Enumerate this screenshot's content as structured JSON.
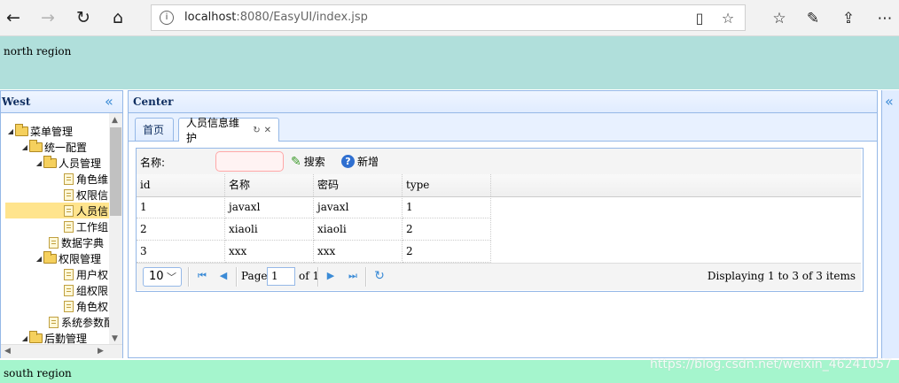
{
  "browser": {
    "url_host": "localhost",
    "url_rest": ":8080/EasyUI/index.jsp",
    "icons": [
      "back-icon",
      "forward-icon",
      "refresh-icon",
      "home-icon",
      "info-icon",
      "reading-view-icon",
      "favorite-star-icon",
      "favorites-list-icon",
      "notes-pen-icon",
      "share-icon",
      "more-icon"
    ]
  },
  "north": {
    "text": "north region"
  },
  "west": {
    "title": "West",
    "tree": [
      {
        "label": "菜单管理",
        "type": "folder"
      },
      {
        "label": "统一配置",
        "type": "folder"
      },
      {
        "label": "人员管理",
        "type": "folder"
      },
      {
        "label": "角色维",
        "type": "file"
      },
      {
        "label": "权限信",
        "type": "file"
      },
      {
        "label": "人员信",
        "type": "file",
        "selected": true
      },
      {
        "label": "工作组",
        "type": "file"
      },
      {
        "label": "数据字典",
        "type": "file"
      },
      {
        "label": "权限管理",
        "type": "folder"
      },
      {
        "label": "用户权",
        "type": "file"
      },
      {
        "label": "组权限",
        "type": "file"
      },
      {
        "label": "角色权",
        "type": "file"
      },
      {
        "label": "系统参数配",
        "type": "file"
      },
      {
        "label": "后勤管理",
        "type": "folder"
      }
    ]
  },
  "center": {
    "title": "Center",
    "tabs": [
      {
        "label": "首页"
      },
      {
        "label": "人员信息维护",
        "active": true
      }
    ],
    "toolbar": {
      "name_label": "名称:",
      "search_label": "搜索",
      "add_label": "新增"
    },
    "grid": {
      "columns": [
        "id",
        "名称",
        "密码",
        "type"
      ],
      "rows": [
        [
          "1",
          "javaxl",
          "javaxl",
          "1"
        ],
        [
          "2",
          "xiaoli",
          "xiaoli",
          "2"
        ],
        [
          "3",
          "xxx",
          "xxx",
          "2"
        ]
      ]
    },
    "pager": {
      "page_size": "10",
      "page_label": "Page",
      "page_number": "1",
      "of_label": "of 1",
      "display_info": "Displaying 1 to 3 of 3 items"
    }
  },
  "south": {
    "text": "south region"
  },
  "watermark": "https://blog.csdn.net/weixin_46241057"
}
